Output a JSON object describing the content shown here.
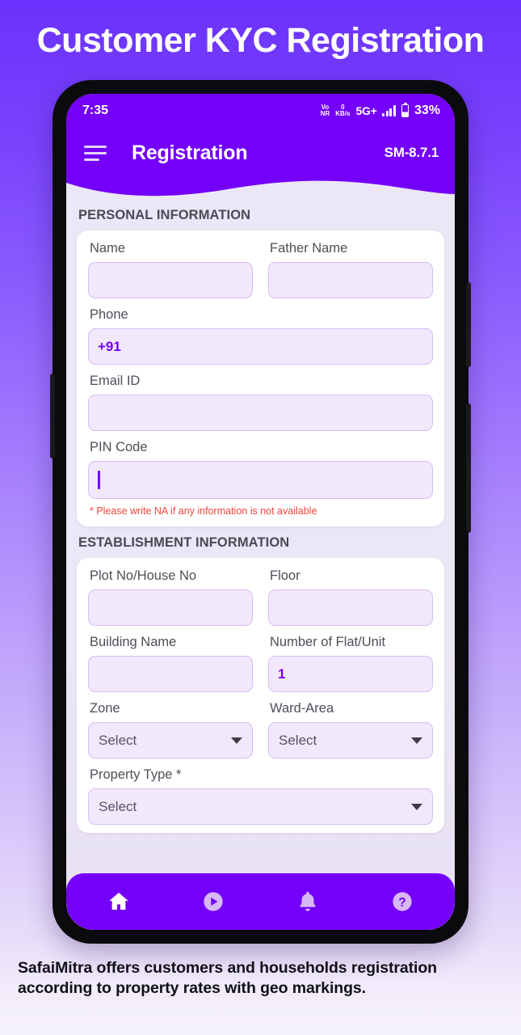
{
  "page": {
    "heading": "Customer KYC Registration",
    "caption": "SafaiMitra offers customers and households registration according to property rates with geo markings."
  },
  "status_bar": {
    "time": "7:35",
    "vonr_top": "Vo",
    "vonr_bottom": "NR",
    "data_rate_value": "0",
    "data_rate_unit": "KB/s",
    "network": "5G+",
    "battery_percent": "33%"
  },
  "app_bar": {
    "menu_icon": "hamburger-menu-icon",
    "title": "Registration",
    "version": "SM-8.7.1"
  },
  "sections": [
    {
      "title": "PERSONAL INFORMATION",
      "hint": "* Please write NA if any information is not available"
    },
    {
      "title": "ESTABLISHMENT INFORMATION"
    }
  ],
  "personal_fields": {
    "name": {
      "label": "Name",
      "value": "",
      "placeholder": ""
    },
    "father_name": {
      "label": "Father Name",
      "value": "",
      "placeholder": ""
    },
    "phone": {
      "label": "Phone",
      "value": "+91",
      "placeholder": ""
    },
    "email": {
      "label": "Email ID",
      "value": "",
      "placeholder": ""
    },
    "pin_code": {
      "label": "PIN Code",
      "value": "",
      "placeholder": "",
      "focused": true
    }
  },
  "establishment_fields": {
    "plot_no": {
      "label": "Plot No/House No",
      "value": "",
      "placeholder": ""
    },
    "floor": {
      "label": "Floor",
      "value": "",
      "placeholder": ""
    },
    "building_name": {
      "label": "Building Name",
      "value": "",
      "placeholder": ""
    },
    "number_of_flat": {
      "label": "Number of Flat/Unit",
      "value": "1",
      "placeholder": ""
    },
    "zone": {
      "label": "Zone",
      "value": "Select"
    },
    "ward_area": {
      "label": "Ward-Area",
      "value": "Select"
    },
    "property_type": {
      "label": "Property Type *",
      "value": "Select"
    }
  },
  "bottom_nav": [
    {
      "name": "home-icon",
      "label": "Home",
      "active": true
    },
    {
      "name": "play-circle-icon",
      "label": "Play",
      "active": false
    },
    {
      "name": "bell-icon",
      "label": "Notifications",
      "active": false
    },
    {
      "name": "help-circle-icon",
      "label": "Help",
      "active": false
    }
  ],
  "colors": {
    "brand_purple": "#7400f9",
    "background_top": "#6b31fc",
    "background_bottom": "#f7f3fc",
    "input_fill": "#f2e8fc",
    "input_border": "#d7bdf3",
    "hint_red": "#f0463c",
    "label_gray": "#4e4e58"
  }
}
